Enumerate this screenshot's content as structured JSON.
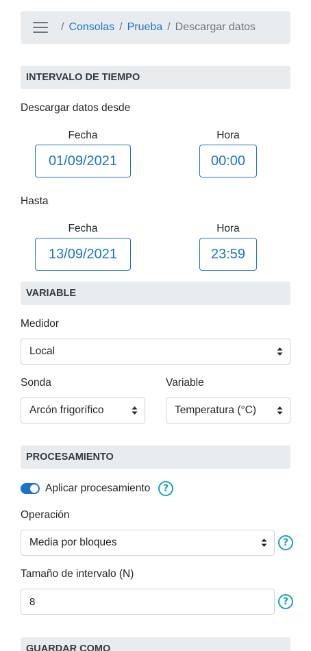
{
  "breadcrumb": {
    "items": [
      "Consolas",
      "Prueba"
    ],
    "current": "Descargar datos",
    "separator": "/"
  },
  "sections": {
    "time": "INTERVALO DE TIEMPO",
    "variable": "VARIABLE",
    "processing": "PROCESAMIENTO",
    "save": "GUARDAR COMO"
  },
  "time_range": {
    "from_label": "Descargar datos desde",
    "to_label": "Hasta",
    "date_label": "Fecha",
    "time_label": "Hora",
    "from_date": "01/09/2021",
    "from_time": "00:00",
    "to_date": "13/09/2021",
    "to_time": "23:59"
  },
  "variable": {
    "meter_label": "Medidor",
    "meter_value": "Local",
    "probe_label": "Sonda",
    "probe_value": "Arcón frigorífico",
    "variable_label": "Variable",
    "variable_value": "Temperatura (°C)"
  },
  "processing": {
    "apply_label": "Aplicar procesamiento",
    "apply_enabled": true,
    "operation_label": "Operación",
    "operation_value": "Media por bloques",
    "interval_label": "Tamaño de intervalo (N)",
    "interval_value": "8",
    "help_glyph": "?"
  },
  "colors": {
    "accent": "#1a73c9",
    "help": "#17a2b8",
    "header_bg": "#e9ecef"
  }
}
